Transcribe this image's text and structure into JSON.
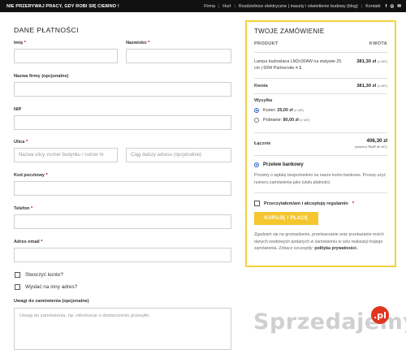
{
  "topbar": {
    "promo": "NIE PRZERYWAJ PRACY, GDY ROBI SIĘ CIEMNO !",
    "links": [
      "Firma",
      "Hurt",
      "Rozdzielnice elektryczne | maszty i oświetlenie budowy (blog)",
      "Kontakt"
    ],
    "social_icons": [
      "facebook-icon",
      "instagram-icon",
      "email-icon"
    ]
  },
  "billing": {
    "title": "DANE PŁATNOŚCI",
    "first_name_label": "Imię",
    "last_name_label": "Nazwisko",
    "company_label": "Nazwa firmy (opcjonalne)",
    "nip_label": "NIP",
    "street_label": "Ulica",
    "street_placeholder": "Nazwa ulicy, numer budynku / numer lo",
    "street2_placeholder": "Ciąg dalszy adresu (opcjonalnie)",
    "postcode_label": "Kod pocztowy",
    "phone_label": "Telefon",
    "email_label": "Adres email",
    "required_mark": "*",
    "create_account": "Stworzyć konto?",
    "ship_elsewhere": "Wysłać na inny adres?",
    "notes_label": "Uwagi do zamówienia (opcjonalne)",
    "notes_placeholder": "Uwagi do zamówienia, np. informacje o dostarczeniu przesyłki."
  },
  "order": {
    "title": "TWOJE ZAMÓWIENIE",
    "col_product": "PRODUKT",
    "col_amount": "KWOTA",
    "item_name": "Lampa budowlana LM2x30AW na statywie 25 cm | 60W Partnersite",
    "item_qty": "× 1",
    "item_price": "381,30 zł",
    "vat_note": "(z VAT)",
    "subtotal_label": "Kwota",
    "subtotal_value": "381,30 zł",
    "shipping_label": "Wysyłka",
    "ship_options": [
      {
        "label": "Kurier:",
        "price": "25,00 zł",
        "selected": true
      },
      {
        "label": "Pobranie:",
        "price": "80,00 zł",
        "selected": false
      }
    ],
    "total_label": "Łącznie",
    "total_value": "406,30 zł",
    "total_vat_prefix": "(zawiera",
    "total_vat_amount": "75,97 zł",
    "total_vat_suffix": "VAT)",
    "payment_method": "Przelew bankowy",
    "payment_desc": "Prosimy o wpłatę bezpośrednio na nasze konto bankowe. Proszę użyć numeru zamówienia jako tytułu płatności.",
    "terms_text": "Przeczytałem/am i akceptuję regulamin",
    "buy_button": "KUPUJĘ I PŁACĘ",
    "consent_text": "Zgadzam się na gromadzenie, przetwarzanie oraz przekazanie moich danych osobowych podanych w zamówieniu w celu realizacji mojego zamówienia. Zobacz szczegóły:",
    "privacy_link": "polityka prywatności."
  },
  "watermark": {
    "brand": "Sprzedajemy",
    "badge": ".pl"
  }
}
